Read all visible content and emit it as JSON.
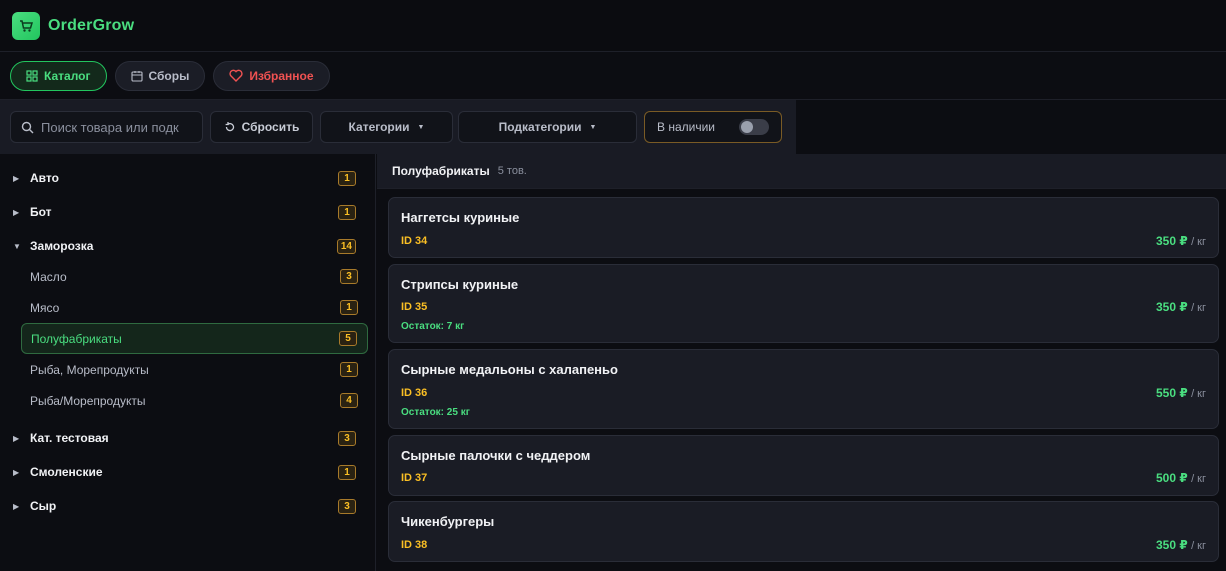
{
  "app": {
    "title": "OrderGrow"
  },
  "nav": {
    "catalog": "Каталог",
    "orders": "Сборы",
    "favorites": "Избранное"
  },
  "filters": {
    "search_placeholder": "Поиск товара или подк",
    "reset": "Сбросить",
    "categories": "Категории",
    "subcategories": "Подкатегории",
    "in_stock": "В наличии"
  },
  "sidebar": {
    "categories": [
      {
        "name": "Авто",
        "count": "1",
        "expanded": false
      },
      {
        "name": "Бот",
        "count": "1",
        "expanded": false
      },
      {
        "name": "Заморозка",
        "count": "14",
        "expanded": true
      },
      {
        "name": "Кат. тестовая",
        "count": "3",
        "expanded": false
      },
      {
        "name": "Смоленские",
        "count": "1",
        "expanded": false
      },
      {
        "name": "Сыр",
        "count": "3",
        "expanded": false
      }
    ],
    "subcategories": [
      {
        "name": "Масло",
        "count": "3"
      },
      {
        "name": "Мясо",
        "count": "1"
      },
      {
        "name": "Полуфабрикаты",
        "count": "5",
        "active": true
      },
      {
        "name": "Рыба, Морепродукты",
        "count": "1"
      },
      {
        "name": "Рыба/Морепродукты",
        "count": "4"
      }
    ]
  },
  "main": {
    "section_title": "Полуфабрикаты",
    "section_count": "5 тов.",
    "products": [
      {
        "name": "Наггетсы куриные",
        "id": "ID 34",
        "price": "350 ₽",
        "unit": "/ кг",
        "rest": ""
      },
      {
        "name": "Стрипсы куриные",
        "id": "ID 35",
        "price": "350 ₽",
        "unit": "/ кг",
        "rest": "Остаток: 7 кг"
      },
      {
        "name": "Сырные медальоны с халапеньо",
        "id": "ID 36",
        "price": "550 ₽",
        "unit": "/ кг",
        "rest": "Остаток: 25 кг"
      },
      {
        "name": "Сырные палочки с чеддером",
        "id": "ID 37",
        "price": "500 ₽",
        "unit": "/ кг",
        "rest": ""
      },
      {
        "name": "Чикенбургеры",
        "id": "ID 38",
        "price": "350 ₽",
        "unit": "/ кг",
        "rest": ""
      }
    ]
  },
  "colors": {
    "accent": "#4ade80",
    "warning": "#fbbf24",
    "danger": "#f05252",
    "bg": "#0c0d12"
  }
}
